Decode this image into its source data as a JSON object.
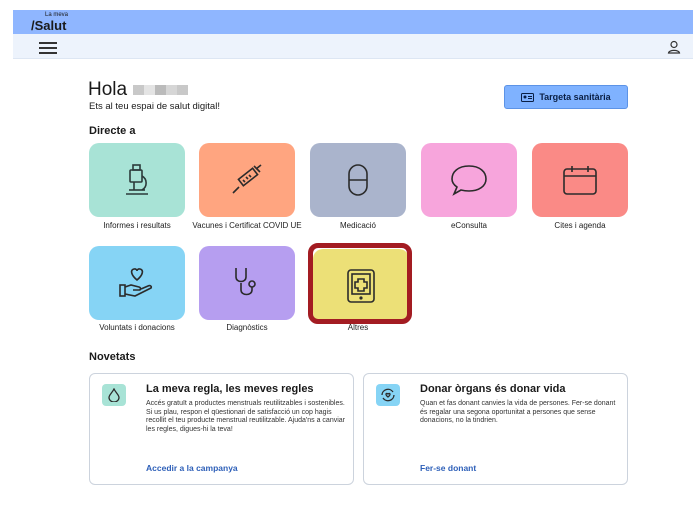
{
  "app": {
    "logo_top": "La meva",
    "logo_bottom": "/Salut"
  },
  "greeting": {
    "hola": "Hola",
    "welcome": "Ets al teu espai de salut digital!"
  },
  "tsbutton": {
    "label": "Targeta sanitària"
  },
  "sections": {
    "directe": "Directe a",
    "novetats": "Novetats"
  },
  "tiles": [
    {
      "label": "Informes i resultats",
      "color": "#a8e3d6",
      "icon": "microscope-icon"
    },
    {
      "label": "Vacunes i Certificat COVID UE",
      "color": "#ffa580",
      "icon": "syringe-icon"
    },
    {
      "label": "Medicació",
      "color": "#aab4cc",
      "icon": "pill-icon"
    },
    {
      "label": "eConsulta",
      "color": "#f7a5dc",
      "icon": "chat-bubble-icon"
    },
    {
      "label": "Cites i agenda",
      "color": "#fa8a86",
      "icon": "calendar-icon"
    },
    {
      "label": "Voluntats i donacions",
      "color": "#86d4f5",
      "icon": "hand-heart-icon"
    },
    {
      "label": "Diagnòstics",
      "color": "#b69ef0",
      "icon": "stethoscope-icon"
    },
    {
      "label": "Altres",
      "color": "#ece077",
      "icon": "tablet-cross-icon"
    }
  ],
  "cards": [
    {
      "title": "La meva regla, les meves regles",
      "body": "Accés gratuït a productes menstruals reutilitzables i sostenibles. Si us plau, respon el qüestionari de satisfacció un cop hagis recollit el teu producte menstrual reutilitzable. Ajuda'ns a canviar les regles, digues-hi la teva!",
      "link": "Accedir a la campanya",
      "icon_color": "#a8e3d6",
      "icon": "drop-icon"
    },
    {
      "title": "Donar òrgans és donar vida",
      "body": "Quan et fas donant canvies la vida de persones. Fer-se donant és regalar una segona oportunitat a persones que sense donacions, no la tindrien.",
      "link": "Fer-se donant",
      "icon_color": "#86d4f5",
      "icon": "heart-cycle-icon"
    }
  ],
  "colors": {
    "topbar": "#8fb6ff",
    "highlight": "#a31c22",
    "link": "#2d5fb8"
  }
}
